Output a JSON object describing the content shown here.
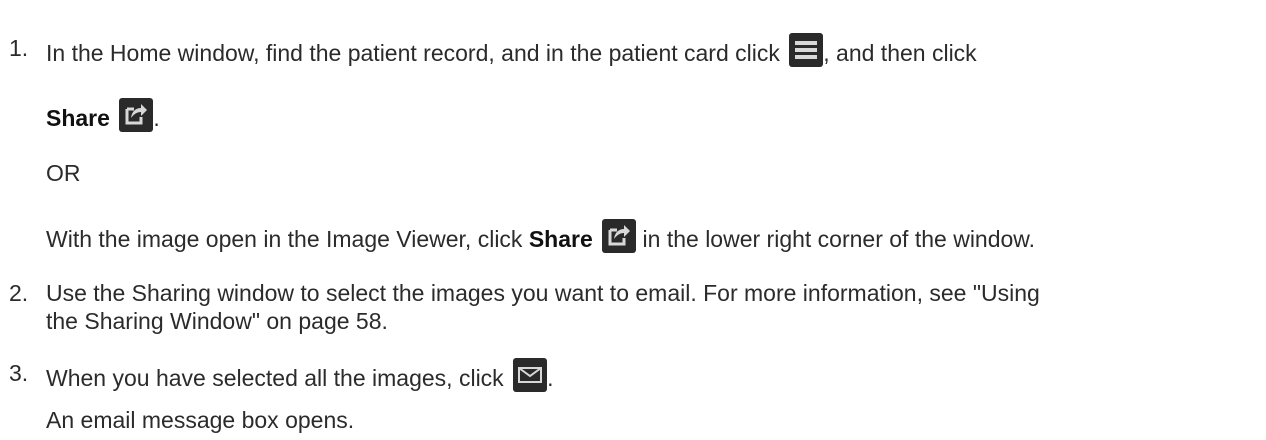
{
  "steps": [
    {
      "number": "1.",
      "line1_a": "In the Home window, find the patient record, and in the patient card click",
      "line1_b": ", and then click",
      "share_label": "Share",
      "share_suffix": ".",
      "or_text": "OR",
      "alt_a": "With the image open in the Image Viewer, click",
      "alt_share_label": "Share",
      "alt_b": "in the lower right corner of the window."
    },
    {
      "number": "2.",
      "line1": "Use the Sharing window to select the images you want to email. For more information, see \"Using",
      "line2": "the Sharing Window\" on page 58."
    },
    {
      "number": "3.",
      "line1_a": "When you have selected all the images, click",
      "line1_b": ".",
      "result": "An email message box opens."
    }
  ],
  "icons": {
    "menu": "hamburger-menu-icon",
    "share": "share-icon",
    "mail": "envelope-icon"
  }
}
